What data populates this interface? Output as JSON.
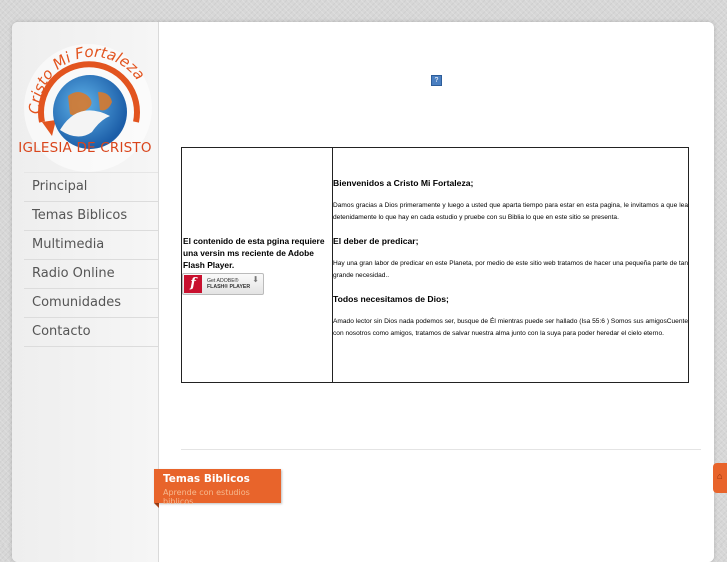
{
  "logo": {
    "arc_text": "Cristo Mi Fortaleza",
    "name": "IGLESIA DE CRISTO"
  },
  "sidebar": {
    "items": [
      {
        "label": "Principal"
      },
      {
        "label": "Temas Biblicos"
      },
      {
        "label": "Multimedia"
      },
      {
        "label": "Radio Online"
      },
      {
        "label": "Comunidades"
      },
      {
        "label": "Contacto"
      }
    ]
  },
  "flash_placeholder": {
    "icon": "question-mark-icon",
    "glyph": "?"
  },
  "flash_notice": {
    "message": "El contenido de esta pgina requiere una versin ms reciente de Adobe Flash Player.",
    "badge_line1": "Get ADOBE®",
    "badge_line2": "FLASH® PLAYER",
    "badge_logo": "f"
  },
  "article": {
    "heading1": "Bienvenidos a Cristo Mi Fortaleza;",
    "para1": "Damos gracias a Dios primeramente y luego a usted que aparta tiempo para estar en esta pagina, le invitamos a que lea detenidamente lo que hay en cada estudio y pruebe con su Biblia lo que en este sitio se presenta.",
    "heading2": "El deber de predicar;",
    "para2": "Hay una gran labor de predicar en este Planeta, por medio de este sitio web tratamos de hacer una pequeña parte de tan grande necesidad..",
    "heading3": "Todos necesitamos de Dios;",
    "para3": "Amado lector sin Dios nada podemos ser, busque de Él mientras puede ser hallado (Isa 55:6 ) Somos sus amigosCuente con nosotros como amigos, tratamos de salvar nuestra alma junto con la suya para poder heredar el cielo eterno."
  },
  "banner": {
    "title": "Temas Biblicos",
    "subtitle": "Aprende con estudios biblicos"
  },
  "colors": {
    "accent": "#e8642b",
    "logo_red": "#d9451c",
    "flash_red": "#c8102e"
  }
}
